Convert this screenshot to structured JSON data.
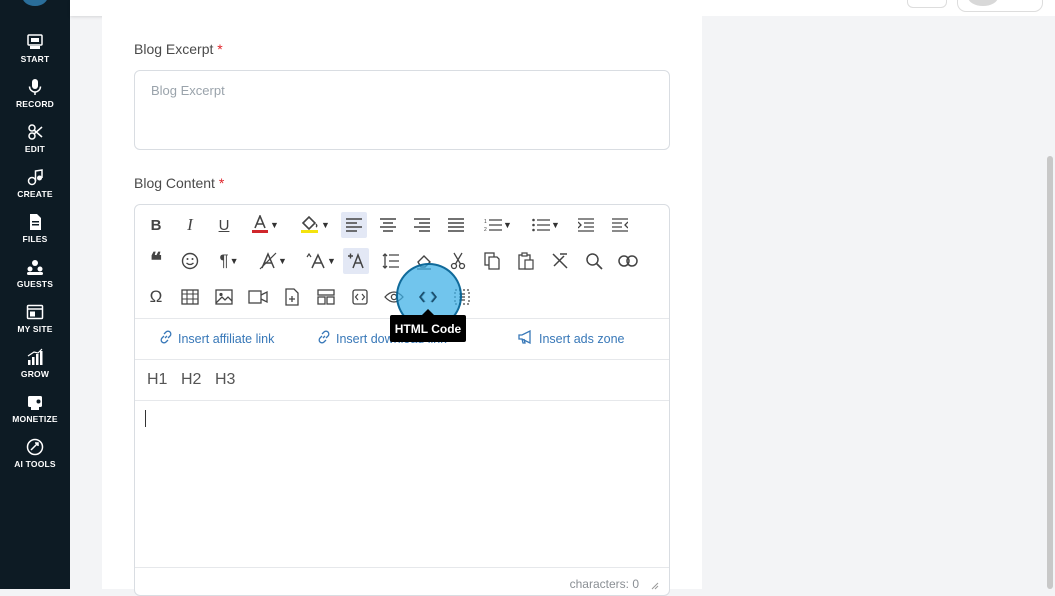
{
  "sidebar": {
    "items": [
      {
        "label": "START",
        "icon": "start-icon"
      },
      {
        "label": "RECORD",
        "icon": "microphone-icon"
      },
      {
        "label": "EDIT",
        "icon": "edit-icon"
      },
      {
        "label": "CREATE",
        "icon": "create-icon"
      },
      {
        "label": "FILES",
        "icon": "files-icon"
      },
      {
        "label": "GUESTS",
        "icon": "guests-icon"
      },
      {
        "label": "MY SITE",
        "icon": "my-site-icon"
      },
      {
        "label": "GROW",
        "icon": "grow-icon"
      },
      {
        "label": "MONETIZE",
        "icon": "monetize-icon"
      },
      {
        "label": "AI TOOLS",
        "icon": "ai-tools-icon"
      }
    ]
  },
  "form": {
    "excerpt": {
      "label": "Blog Excerpt",
      "required_mark": "*",
      "placeholder": "Blog Excerpt",
      "value": ""
    },
    "content": {
      "label": "Blog Content",
      "required_mark": "*"
    }
  },
  "editor": {
    "toolbar_row1": [
      "bold",
      "italic",
      "underline",
      "text-color",
      "background-color",
      "align-left",
      "align-center",
      "align-right",
      "align-justify",
      "ordered-list",
      "unordered-list",
      "indent",
      "outdent"
    ],
    "toolbar_row2": [
      "quote",
      "emoticons",
      "paragraph-format",
      "paragraph-style",
      "font-size",
      "insert-ai",
      "line-height",
      "clear-formatting",
      "cut",
      "copy",
      "paste",
      "remove-format",
      "find",
      "insert-link"
    ],
    "toolbar_row3": [
      "special-characters",
      "insert-table",
      "insert-image",
      "insert-video",
      "insert-file",
      "embed",
      "code-view",
      "html-code",
      "preview",
      "select-all"
    ],
    "tooltip": "HTML Code",
    "insert_links": {
      "affiliate": "Insert affiliate link",
      "download": "Insert download link",
      "ads": "Insert ads zone"
    },
    "headings": [
      "H1",
      "H2",
      "H3"
    ],
    "char_count": "characters: 0",
    "colors": {
      "text_color_bar": "#d0262b",
      "bg_color_bar": "#f4e30e",
      "link": "#3878b8",
      "highlight": "#3aafe6"
    }
  }
}
